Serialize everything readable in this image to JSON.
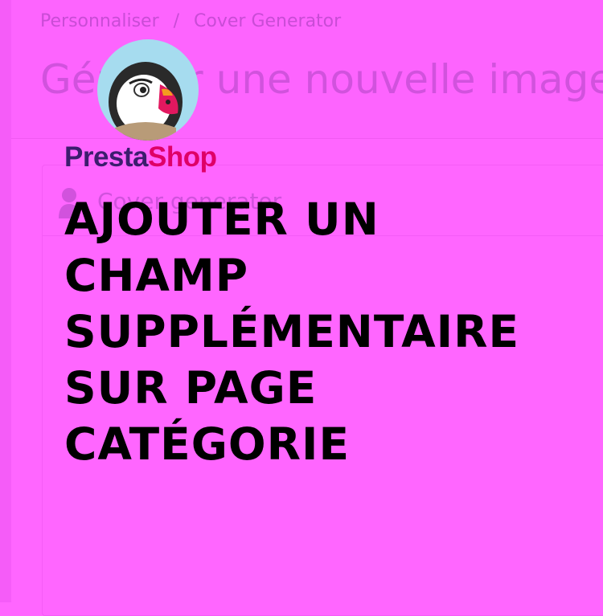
{
  "breadcrumb": {
    "parent": "Personnaliser",
    "separator": "/",
    "current": "Cover Generator"
  },
  "page": {
    "title": "Générer une nouvelle image"
  },
  "panel": {
    "heading": "Cover generator"
  },
  "brand": {
    "part1": "Presta",
    "part2": "Shop"
  },
  "headline": {
    "lines": [
      "AJOUTER UN",
      "CHAMP",
      "SUPPLÉMENTAIRE",
      "SUR PAGE",
      "CATÉGORIE"
    ]
  },
  "colors": {
    "background": "#ff66ff",
    "headline": "#000000",
    "brand_dark": "#3c1d6e",
    "brand_pink": "#df0067",
    "logo_circle": "#a6dcef"
  },
  "icons": {
    "panel": "user-icon",
    "logo": "puffin-mascot-icon"
  }
}
